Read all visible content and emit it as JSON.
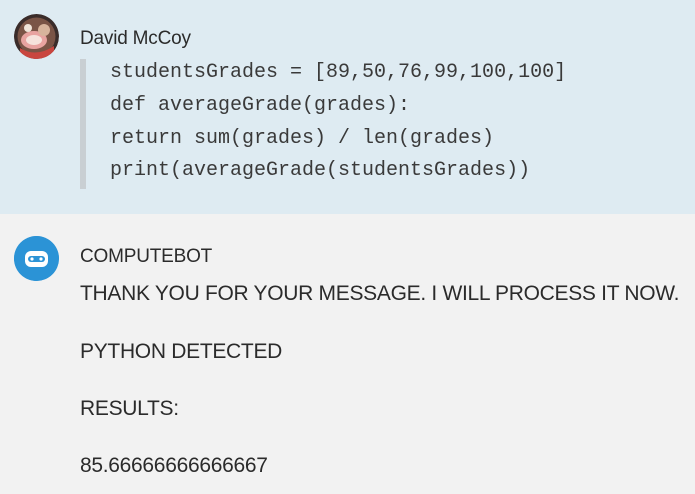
{
  "conversation": {
    "messages": [
      {
        "sender": "David McCoy",
        "code_lines": [
          "studentsGrades = [89,50,76,99,100,100]",
          "def averageGrade(grades):",
          "return sum(grades) / len(grades)",
          "print(averageGrade(studentsGrades))"
        ]
      },
      {
        "sender": "COMPUTEBOT",
        "lines": [
          "THANK YOU FOR YOUR MESSAGE. I WILL PROCESS IT NOW.",
          "PYTHON DETECTED",
          "RESULTS:",
          "85.66666666666667"
        ]
      }
    ]
  },
  "colors": {
    "user_message_bg": "#deebf2",
    "bot_message_bg": "#f2f2f2",
    "bot_avatar": "#2b93d6",
    "code_border": "#c9cfd3"
  },
  "icons": {
    "user_avatar": "user-photo-avatar",
    "bot_avatar": "robot-icon"
  }
}
